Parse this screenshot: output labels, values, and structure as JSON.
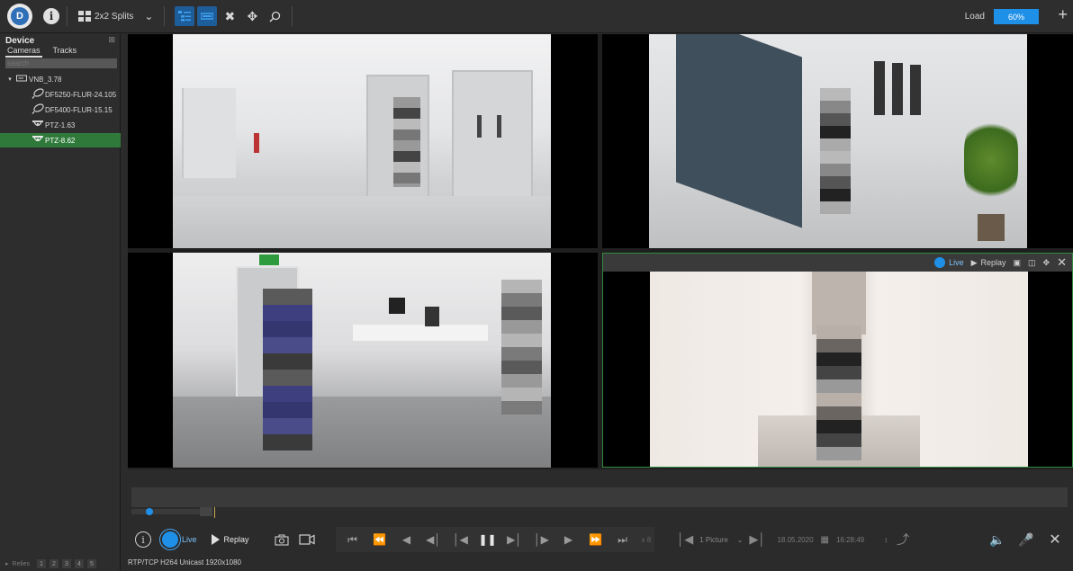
{
  "toolbar": {
    "logo_text": "D",
    "info_label": "i",
    "layout_label": "2x2 Splits",
    "load_label": "Load",
    "load_value": "60%",
    "load_fraction": 0.6,
    "add_label": "+"
  },
  "sidebar": {
    "title": "Device",
    "tabs": [
      "Cameras",
      "Tracks"
    ],
    "search_placeholder": "search",
    "tree": [
      {
        "label": "VNB_3.78",
        "icon": "recorder-icon",
        "level": 0
      },
      {
        "label": "DF5250-FLUR-24.105",
        "icon": "camera-icon",
        "level": 1
      },
      {
        "label": "DF5400-FLUR-15.15",
        "icon": "camera-icon",
        "level": 1
      },
      {
        "label": "PTZ-1.63",
        "icon": "dome-camera-icon",
        "level": 1
      },
      {
        "label": "PTZ-8.62",
        "icon": "dome-camera-icon",
        "level": 1,
        "selected": true
      }
    ],
    "footer": {
      "label": "Relies",
      "pages": [
        "1",
        "2",
        "3",
        "4",
        "5"
      ]
    }
  },
  "cell_toolbar": {
    "live_label": "Live",
    "replay_label": "Replay"
  },
  "controls": {
    "info_label": "i",
    "live_label": "Live",
    "replay_label": "Replay",
    "speed_label": "x 8",
    "picture_label": "1 Picture",
    "date": "18.05.2020",
    "time": "16:28:49"
  },
  "status": {
    "text": "RTP/TCP H264 Unicast 1920x1080"
  }
}
